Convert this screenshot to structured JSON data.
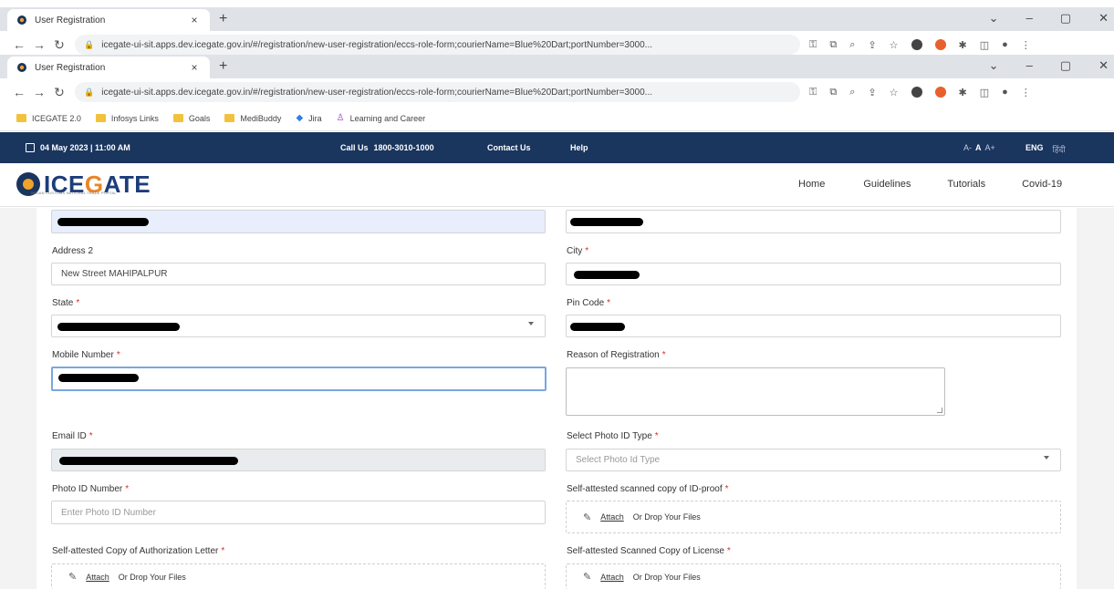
{
  "browser": {
    "tab_title": "User Registration",
    "url": "icegate-ui-sit.apps.dev.icegate.gov.in/#/registration/new-user-registration/eccs-role-form;courierName=Blue%20Dart;portNumber=3000...",
    "new_tab": "+",
    "tab_close": "×",
    "window_controls": {
      "dropdown": "⌄",
      "minimize": "–",
      "restore": "▢",
      "close": "✕"
    },
    "bookmarks": [
      {
        "label": "ICEGATE 2.0",
        "icon": "folder-icon"
      },
      {
        "label": "Infosys Links",
        "icon": "folder-icon"
      },
      {
        "label": "Goals",
        "icon": "folder-icon"
      },
      {
        "label": "MediBuddy",
        "icon": "folder-icon"
      },
      {
        "label": "Jira",
        "icon": "jira-icon"
      },
      {
        "label": "Learning and Career",
        "icon": "learning-icon"
      }
    ]
  },
  "topbar": {
    "datetime": "04 May 2023 | 11:00 AM",
    "call_label": "Call Us",
    "call_number": "1800-3010-1000",
    "contact": "Contact Us",
    "help": "Help",
    "font_small": "A-",
    "font_normal": "A",
    "font_large": "A+",
    "lang_en": "ENG",
    "lang_hi": "हिंदी"
  },
  "header": {
    "logo_prefix": "ICE",
    "logo_accent": "G",
    "logo_suffix": "ATE",
    "logo_tag": "INDIAN CUSTOMS NATIONAL TRADE PORTAL",
    "nav": [
      "Home",
      "Guidelines",
      "Tutorials",
      "Covid-19"
    ]
  },
  "form": {
    "address2_label": "Address 2",
    "address2_value": "New Street MAHIPALPUR",
    "city_label": "City",
    "state_label": "State",
    "pincode_label": "Pin Code",
    "mobile_label": "Mobile Number",
    "reason_label": "Reason of Registration",
    "email_label": "Email ID",
    "photo_type_label": "Select Photo ID Type",
    "photo_type_placeholder": "Select Photo Id Type",
    "photo_number_label": "Photo ID Number",
    "photo_number_placeholder": "Enter Photo ID Number",
    "id_proof_label": "Self-attested scanned copy of ID-proof",
    "auth_letter_label": "Self-attested Copy of Authorization Letter",
    "license_label": "Self-attested Scanned Copy of License",
    "attach_label": "Attach",
    "drop_label": "Or Drop Your Files",
    "required_mark": "*"
  }
}
